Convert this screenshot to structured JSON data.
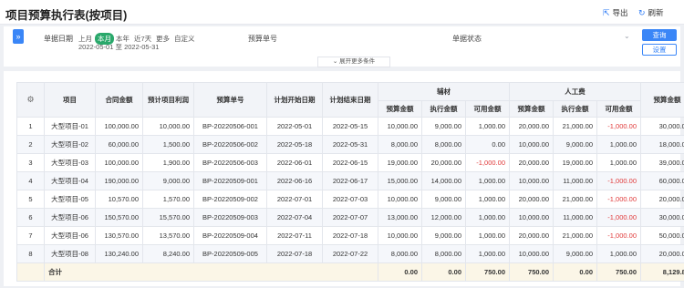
{
  "page": {
    "title": "项目预算执行表(按项目)"
  },
  "actions": {
    "export": "导出",
    "refresh": "刷新"
  },
  "filter": {
    "date_label": "单据日期",
    "quick_dates": [
      "上月",
      "本月",
      "本年",
      "近7天",
      "更多",
      "自定义"
    ],
    "active_quick": "本月",
    "date_start": "2022-05-01",
    "date_sep": "至",
    "date_end": "2022-05-31",
    "budget_no_label": "预算单号",
    "status_label": "单据状态",
    "query_btn": "查询",
    "reset_btn": "设置",
    "expand_label": "展开更多条件"
  },
  "table": {
    "headers": {
      "seq": "",
      "project": "项目",
      "contract_amount": "合同金额",
      "expected_profit": "预计项目利润",
      "budget_no": "预算单号",
      "plan_start": "计划开始日期",
      "plan_end": "计划结束日期",
      "group_material": "辅材",
      "group_labor": "人工费",
      "budget_amount": "预算金额",
      "exec_amount": "执行金额",
      "avail_amount": "可用金额",
      "budget_amount_last": "预算金额"
    },
    "rows": [
      {
        "no": "1",
        "project": "大型项目-01",
        "contract": "100,000.00",
        "profit": "10,000.00",
        "budget_no": "BP-20220506-001",
        "start": "2022-05-01",
        "end": "2022-05-15",
        "m_budget": "10,000.00",
        "m_exec": "9,000.00",
        "m_avail": "1,000.00",
        "l_budget": "20,000.00",
        "l_exec": "21,000.00",
        "l_avail": "-1,000.00",
        "total": "30,000.00"
      },
      {
        "no": "2",
        "project": "大型项目-02",
        "contract": "60,000.00",
        "profit": "1,500.00",
        "budget_no": "BP-20220506-002",
        "start": "2022-05-18",
        "end": "2022-05-31",
        "m_budget": "8,000.00",
        "m_exec": "8,000.00",
        "m_avail": "0.00",
        "l_budget": "10,000.00",
        "l_exec": "9,000.00",
        "l_avail": "1,000.00",
        "total": "18,000.00"
      },
      {
        "no": "3",
        "project": "大型项目-03",
        "contract": "100,000.00",
        "profit": "1,900.00",
        "budget_no": "BP-20220506-003",
        "start": "2022-06-01",
        "end": "2022-06-15",
        "m_budget": "19,000.00",
        "m_exec": "20,000.00",
        "m_avail": "-1,000.00",
        "l_budget": "20,000.00",
        "l_exec": "19,000.00",
        "l_avail": "1,000.00",
        "total": "39,000.00"
      },
      {
        "no": "4",
        "project": "大型项目-04",
        "contract": "190,000.00",
        "profit": "9,000.00",
        "budget_no": "BP-20220509-001",
        "start": "2022-06-16",
        "end": "2022-06-17",
        "m_budget": "15,000.00",
        "m_exec": "14,000.00",
        "m_avail": "1,000.00",
        "l_budget": "10,000.00",
        "l_exec": "11,000.00",
        "l_avail": "-1,000.00",
        "total": "60,000.00"
      },
      {
        "no": "5",
        "project": "大型项目-05",
        "contract": "10,570.00",
        "profit": "1,570.00",
        "budget_no": "BP-20220509-002",
        "start": "2022-07-01",
        "end": "2022-07-03",
        "m_budget": "10,000.00",
        "m_exec": "9,000.00",
        "m_avail": "1,000.00",
        "l_budget": "20,000.00",
        "l_exec": "21,000.00",
        "l_avail": "-1,000.00",
        "total": "20,000.00"
      },
      {
        "no": "6",
        "project": "大型项目-06",
        "contract": "150,570.00",
        "profit": "15,570.00",
        "budget_no": "BP-20220509-003",
        "start": "2022-07-04",
        "end": "2022-07-07",
        "m_budget": "13,000.00",
        "m_exec": "12,000.00",
        "m_avail": "1,000.00",
        "l_budget": "10,000.00",
        "l_exec": "11,000.00",
        "l_avail": "-1,000.00",
        "total": "30,000.00"
      },
      {
        "no": "7",
        "project": "大型项目-06",
        "contract": "130,570.00",
        "profit": "13,570.00",
        "budget_no": "BP-20220509-004",
        "start": "2022-07-11",
        "end": "2022-07-18",
        "m_budget": "10,000.00",
        "m_exec": "9,000.00",
        "m_avail": "1,000.00",
        "l_budget": "20,000.00",
        "l_exec": "21,000.00",
        "l_avail": "-1,000.00",
        "total": "50,000.00"
      },
      {
        "no": "8",
        "project": "大型项目-08",
        "contract": "130,240.00",
        "profit": "8,240.00",
        "budget_no": "BP-20220509-005",
        "start": "2022-07-18",
        "end": "2022-07-22",
        "m_budget": "8,000.00",
        "m_exec": "8,000.00",
        "m_avail": "1,000.00",
        "l_budget": "10,000.00",
        "l_exec": "9,000.00",
        "l_avail": "1,000.00",
        "total": "20,000.00"
      }
    ],
    "summary": {
      "label": "合计",
      "m_budget": "0.00",
      "m_exec": "0.00",
      "m_avail": "750.00",
      "l_budget": "750.00",
      "l_exec": "0.00",
      "l_avail": "750.00",
      "total": "8,129.84"
    }
  },
  "colors": {
    "primary": "#3a86f7",
    "active": "#2aa86b",
    "negative": "#e03a3a"
  },
  "icons": {
    "export": "export-icon",
    "refresh": "refresh-icon",
    "settings": "gear-icon"
  }
}
